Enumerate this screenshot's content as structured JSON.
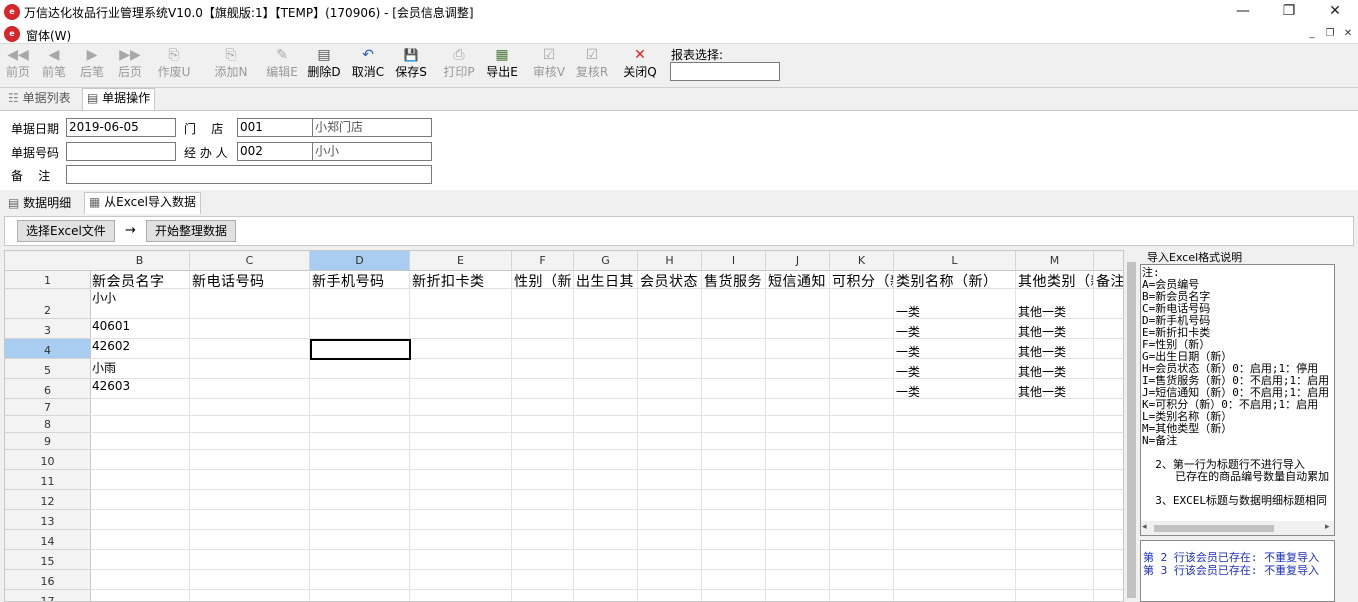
{
  "window": {
    "title": "万信达化妆品行业管理系统V10.0【旗舰版:1】【TEMP】(170906) - [会员信息调整]",
    "logo_text": "e",
    "minimize": "—",
    "restore": "❐",
    "close": "✕"
  },
  "menu": {
    "item": "窗体(W)",
    "mdi_min": "_",
    "mdi_restore": "❐",
    "mdi_close": "✕"
  },
  "toolbar": {
    "buttons": [
      {
        "label": "前页",
        "icon": "◀◀"
      },
      {
        "label": "前笔",
        "icon": "◀"
      },
      {
        "label": "后笔",
        "icon": "▶"
      },
      {
        "label": "后页",
        "icon": "▶▶"
      },
      {
        "label": "作废U",
        "icon": "⎘"
      },
      {
        "label": "添加N",
        "icon": "⎘"
      },
      {
        "label": "编辑E",
        "icon": "✎"
      },
      {
        "label": "删除D",
        "icon": "▤"
      },
      {
        "label": "取消C",
        "icon": "↶"
      },
      {
        "label": "保存S",
        "icon": "💾"
      },
      {
        "label": "打印P",
        "icon": "⎙"
      },
      {
        "label": "导出E",
        "icon": "▦"
      },
      {
        "label": "审核V",
        "icon": "☑"
      },
      {
        "label": "复核R",
        "icon": "☑"
      },
      {
        "label": "关闭Q",
        "icon": "✕"
      }
    ],
    "report_label": "报表选择:",
    "report_value": ""
  },
  "tabs_top": {
    "list": "单据列表",
    "operate": "单据操作"
  },
  "form": {
    "date_label": "单据日期",
    "date_value": "2019-06-05",
    "store_label": "门    店",
    "store_code": "001",
    "store_name": "小郑门店",
    "number_label": "单据号码",
    "number_value": "",
    "handler_label": "经 办 人",
    "handler_code": "002",
    "handler_name": "小小",
    "remark_label": "备    注",
    "remark_value": ""
  },
  "tabs_mid": {
    "detail": "数据明细",
    "excel": "从Excel导入数据"
  },
  "actions": {
    "select_file": "选择Excel文件",
    "arrow": "→",
    "start": "开始整理数据"
  },
  "grid": {
    "columns": [
      "B",
      "C",
      "D",
      "E",
      "F",
      "G",
      "H",
      "I",
      "J",
      "K",
      "L",
      "M",
      ""
    ],
    "rows": [
      "1",
      "2",
      "3",
      "4",
      "5",
      "6",
      "7",
      "8",
      "9",
      "10",
      "11",
      "12",
      "13",
      "14",
      "15",
      "16",
      "17"
    ],
    "header_row": [
      "新会员名字",
      "新电话号码",
      "新手机号码",
      "新折扣卡类",
      "性别（新",
      "出生日其",
      "会员状态",
      "售货服务",
      "短信通知",
      "可积分（新",
      "类别名称（新）",
      "其他类别（新",
      "备注"
    ],
    "data": [
      {
        "b": "小小",
        "l": "一类",
        "m": "其他一类"
      },
      {
        "b": "40601",
        "l": "一类",
        "m": "其他一类"
      },
      {
        "b": "42602",
        "l": "一类",
        "m": "其他一类"
      },
      {
        "b": "小雨",
        "l": "一类",
        "m": "其他一类"
      },
      {
        "b": "42603",
        "l": "一类",
        "m": "其他一类"
      }
    ]
  },
  "side": {
    "legend": "导入Excel格式说明",
    "notes": [
      "注:",
      "A=会员编号",
      "B=新会员名字",
      "C=新电话号码",
      "D=新手机号码",
      "E=新折扣卡类",
      "F=性别（新）",
      "G=出生日期（新）",
      "H=会员状态（新）0：启用;1：停用",
      "I=售货服务（新）0：不启用;1：启用",
      "J=短信通知（新）0：不启用;1：启用",
      "K=可积分（新）0：不启用;1：启用",
      "L=类别名称（新）",
      "M=其他类型（新）",
      "N=备注",
      "",
      "  2、第一行为标题行不进行导入",
      "     已存在的商品编号数量自动累加",
      "",
      "  3、EXCEL标题与数据明细标题相同"
    ],
    "messages": [
      "第 2 行该会员已存在: 不重复导入",
      "第 3 行该会员已存在: 不重复导入"
    ]
  }
}
